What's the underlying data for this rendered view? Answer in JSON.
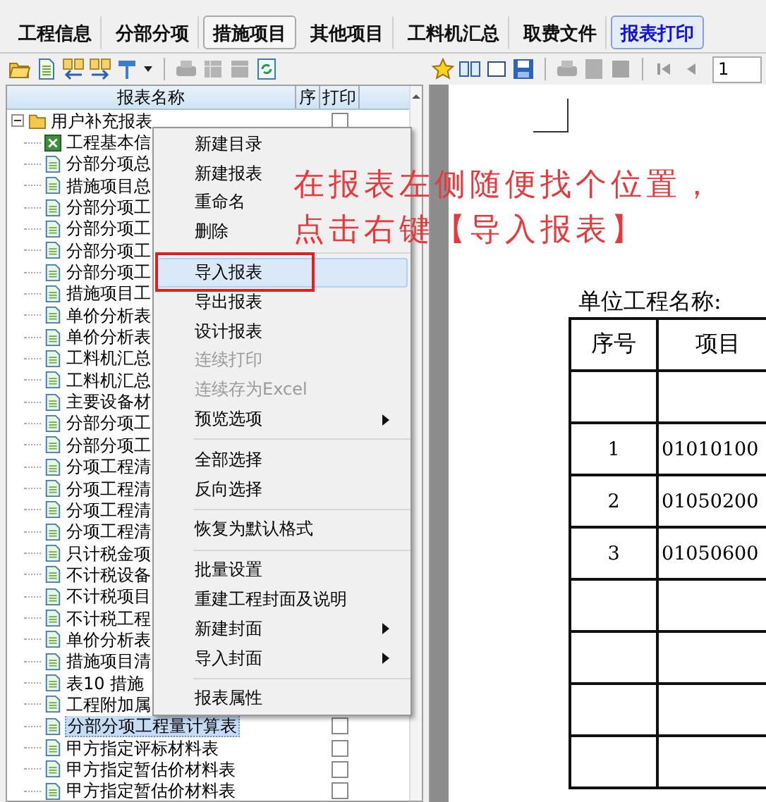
{
  "tabs": [
    {
      "label": "工程信息",
      "selected": false,
      "hovered": false
    },
    {
      "label": "分部分项",
      "selected": false,
      "hovered": false
    },
    {
      "label": "措施项目",
      "selected": false,
      "hovered": true
    },
    {
      "label": "其他项目",
      "selected": false,
      "hovered": false
    },
    {
      "label": "工料机汇总",
      "selected": false,
      "hovered": false
    },
    {
      "label": "取费文件",
      "selected": false,
      "hovered": false
    },
    {
      "label": "报表打印",
      "selected": true,
      "hovered": false
    }
  ],
  "report_tree": {
    "columns": [
      "报表名称",
      "序",
      "打印"
    ],
    "root": {
      "label": "用户补充报表",
      "expanded": true,
      "checked": false,
      "children": [
        {
          "label": "工程基本信",
          "kind": "excel",
          "selected": false
        },
        {
          "label": "分部分项总",
          "kind": "report",
          "selected": false
        },
        {
          "label": "措施项目总",
          "kind": "report",
          "selected": false
        },
        {
          "label": "分部分项工",
          "kind": "report",
          "selected": false
        },
        {
          "label": "分部分项工",
          "kind": "report",
          "selected": false
        },
        {
          "label": "分部分项工",
          "kind": "report",
          "selected": false
        },
        {
          "label": "分部分项工",
          "kind": "report",
          "selected": false
        },
        {
          "label": "措施项目工",
          "kind": "report",
          "selected": false
        },
        {
          "label": "单价分析表",
          "kind": "report",
          "selected": false
        },
        {
          "label": "单价分析表",
          "kind": "report",
          "selected": false
        },
        {
          "label": "工料机汇总",
          "kind": "report",
          "selected": false
        },
        {
          "label": "工料机汇总",
          "kind": "report",
          "selected": false
        },
        {
          "label": "主要设备材",
          "kind": "report",
          "selected": false
        },
        {
          "label": "分部分项工",
          "kind": "report",
          "selected": false
        },
        {
          "label": "分部分项工",
          "kind": "report",
          "selected": false
        },
        {
          "label": "分项工程清",
          "kind": "report",
          "selected": false
        },
        {
          "label": "分项工程清",
          "kind": "report",
          "selected": false
        },
        {
          "label": "分项工程清",
          "kind": "report",
          "selected": false
        },
        {
          "label": "分项工程清",
          "kind": "report",
          "selected": false
        },
        {
          "label": "只计税金项",
          "kind": "report",
          "selected": false
        },
        {
          "label": "不计税设备",
          "kind": "report",
          "selected": false
        },
        {
          "label": "不计税项目",
          "kind": "report",
          "selected": false
        },
        {
          "label": "不计税工程",
          "kind": "report",
          "selected": false
        },
        {
          "label": "单价分析表",
          "kind": "report",
          "selected": false
        },
        {
          "label": "措施项目清",
          "kind": "report",
          "selected": false
        },
        {
          "label": "表10 措施",
          "kind": "report",
          "selected": false
        },
        {
          "label": "工程附加属",
          "kind": "report",
          "selected": false
        },
        {
          "label": "分部分项工程量计算表",
          "kind": "report",
          "selected": true,
          "checked": false
        },
        {
          "label": "甲方指定评标材料表",
          "kind": "report",
          "selected": false,
          "checked": false
        },
        {
          "label": "甲方指定暂估价材料表",
          "kind": "report",
          "selected": false,
          "checked": false
        },
        {
          "label": "甲方指定暂估价材料表",
          "kind": "report",
          "selected": false,
          "checked": false
        }
      ]
    }
  },
  "context_menu": {
    "items": [
      {
        "kind": "item",
        "label": "新建目录",
        "disabled": false,
        "selected": false
      },
      {
        "kind": "item",
        "label": "新建报表",
        "disabled": false,
        "selected": false
      },
      {
        "kind": "item",
        "label": "重命名",
        "disabled": false,
        "selected": false
      },
      {
        "kind": "item",
        "label": "删除",
        "disabled": false,
        "selected": false
      },
      {
        "kind": "separator"
      },
      {
        "kind": "item",
        "label": "导入报表",
        "disabled": false,
        "selected": true
      },
      {
        "kind": "item",
        "label": "导出报表",
        "disabled": false,
        "selected": false
      },
      {
        "kind": "item",
        "label": "设计报表",
        "disabled": false,
        "selected": false
      },
      {
        "kind": "item",
        "label": "连续打印",
        "disabled": true,
        "selected": false
      },
      {
        "kind": "item",
        "label": "连续存为Excel",
        "disabled": true,
        "selected": false
      },
      {
        "kind": "submenu",
        "label": "预览选项",
        "disabled": false,
        "selected": false
      },
      {
        "kind": "separator"
      },
      {
        "kind": "item",
        "label": "全部选择",
        "disabled": false,
        "selected": false
      },
      {
        "kind": "item",
        "label": "反向选择",
        "disabled": false,
        "selected": false
      },
      {
        "kind": "separator"
      },
      {
        "kind": "item",
        "label": "恢复为默认格式",
        "disabled": false,
        "selected": false
      },
      {
        "kind": "separator"
      },
      {
        "kind": "item",
        "label": "批量设置",
        "disabled": false,
        "selected": false
      },
      {
        "kind": "item",
        "label": "重建工程封面及说明",
        "disabled": false,
        "selected": false
      },
      {
        "kind": "submenu",
        "label": "新建封面",
        "disabled": false,
        "selected": false
      },
      {
        "kind": "submenu",
        "label": "导入封面",
        "disabled": false,
        "selected": false
      },
      {
        "kind": "separator"
      },
      {
        "kind": "item",
        "label": "报表属性",
        "disabled": false,
        "selected": false
      }
    ]
  },
  "annotation": {
    "lines": [
      "在报表左侧随便找个位置，",
      "点击右键【导入报表】"
    ]
  },
  "preview": {
    "page_number": "1",
    "title": "单位工程名称:",
    "table": {
      "columns": [
        "序号",
        "项目"
      ],
      "rows": [
        {},
        {
          "number": "1",
          "code": "01010100"
        },
        {
          "number": "2",
          "code": "01050200"
        },
        {
          "number": "3",
          "code": "01050600"
        },
        {},
        {},
        {},
        {}
      ]
    }
  }
}
